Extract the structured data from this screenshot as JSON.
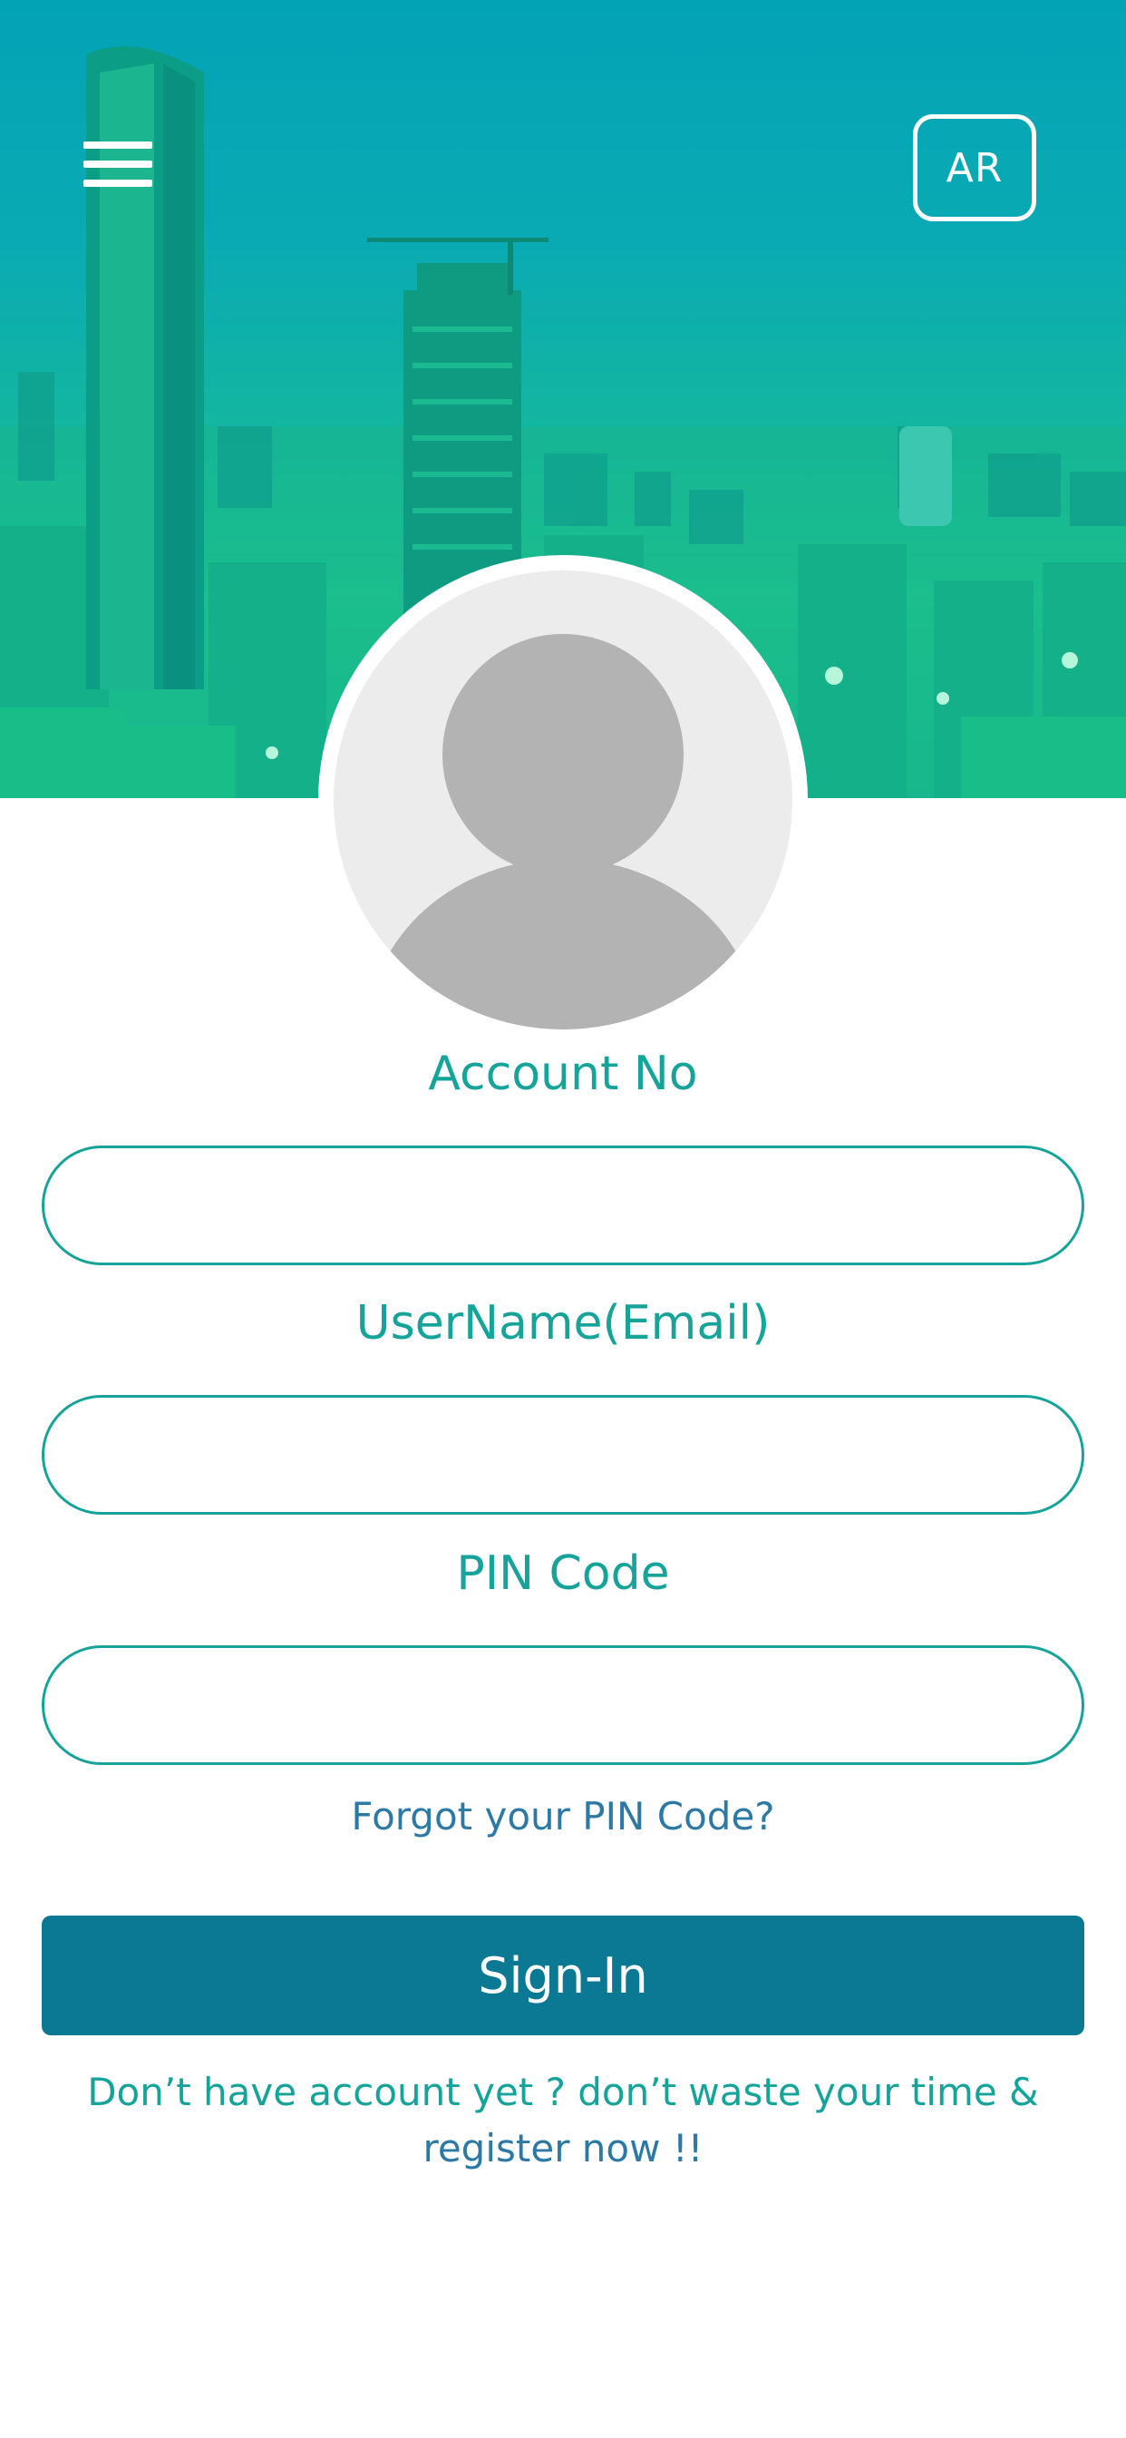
{
  "header": {
    "language_button": "AR",
    "menu_icon": "hamburger-menu-icon"
  },
  "avatar": {
    "icon": "user-avatar-placeholder-icon"
  },
  "form": {
    "account_label": "Account No",
    "account_value": "",
    "username_label": "UserName(Email)",
    "username_value": "",
    "pin_label": "PIN Code",
    "pin_value": "",
    "forgot_link": "Forgot your PIN Code?",
    "signin_button": "Sign-In",
    "register_lead": "Don’t have account yet ? don’t waste your time &",
    "register_link": "register now !!"
  },
  "colors": {
    "accent": "#16a39a",
    "button": "#0b7894",
    "link": "#2d79a6",
    "header_top": "#03a3b6",
    "header_bottom": "#1fc98a"
  }
}
